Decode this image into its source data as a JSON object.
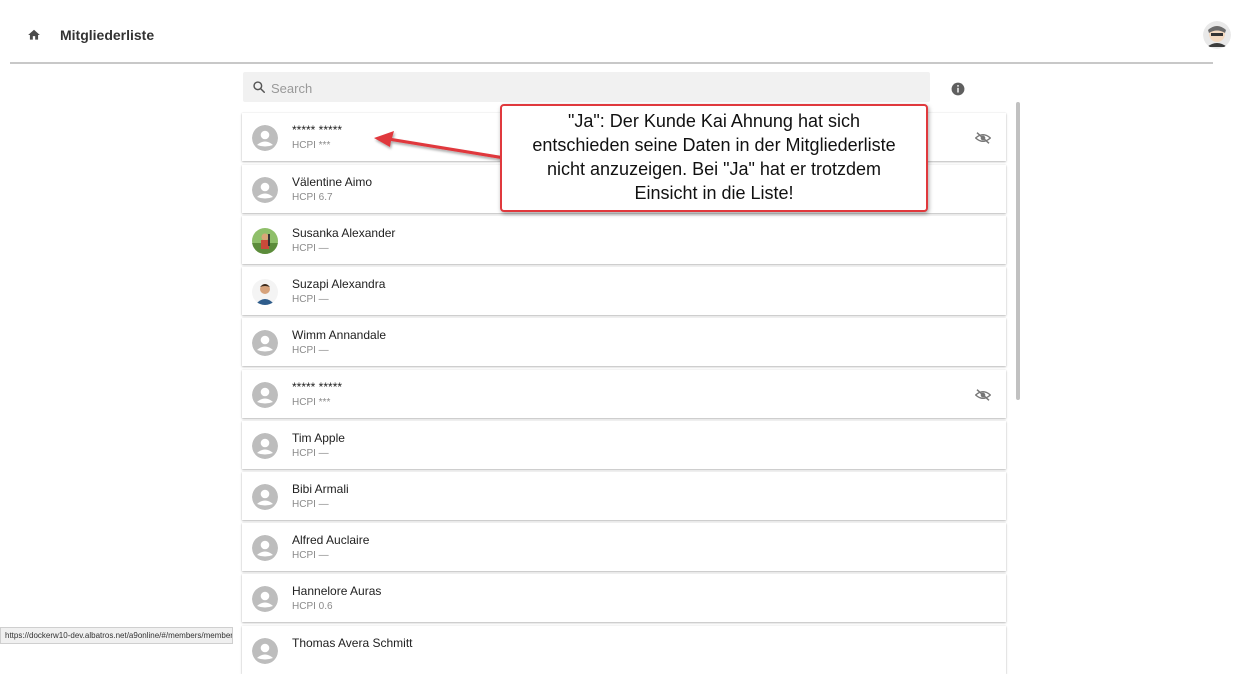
{
  "header": {
    "title": "Mitgliederliste",
    "home_icon": "home-icon",
    "avatar_icon": "user-avatar"
  },
  "search": {
    "placeholder": "Search",
    "value": ""
  },
  "info_icon": "info-icon",
  "members": [
    {
      "name": "***** *****",
      "hcp": "HCPI ***",
      "hidden": true,
      "avatar": "default"
    },
    {
      "name": "Välentine Aimo",
      "hcp": "HCPI 6.7",
      "hidden": false,
      "avatar": "default"
    },
    {
      "name": "Susanka Alexander",
      "hcp": "HCPI —",
      "hidden": false,
      "avatar": "photo"
    },
    {
      "name": "Suzapi Alexandra",
      "hcp": "HCPI —",
      "hidden": false,
      "avatar": "photo"
    },
    {
      "name": "Wimm Annandale",
      "hcp": "HCPI —",
      "hidden": false,
      "avatar": "default"
    },
    {
      "name": "***** *****",
      "hcp": "HCPI ***",
      "hidden": true,
      "avatar": "default"
    },
    {
      "name": "Tim Apple",
      "hcp": "HCPI —",
      "hidden": false,
      "avatar": "default"
    },
    {
      "name": "Bibi Armali",
      "hcp": "HCPI —",
      "hidden": false,
      "avatar": "default"
    },
    {
      "name": "Alfred Auclaire",
      "hcp": "HCPI —",
      "hidden": false,
      "avatar": "default"
    },
    {
      "name": "Hannelore Auras",
      "hcp": "HCPI 0.6",
      "hidden": false,
      "avatar": "default"
    },
    {
      "name": "Thomas Avera Schmitt",
      "hcp": "",
      "hidden": false,
      "avatar": "default"
    }
  ],
  "callout": {
    "lines": [
      "\"Ja\": Der Kunde Kai Ahnung hat sich",
      "entschieden seine Daten in der Mitgliederliste",
      "nicht anzuzeigen. Bei \"Ja\" hat er trotzdem",
      "Einsicht in die Liste!"
    ],
    "border_color": "#e0393d"
  },
  "status_url": "https://dockerw10-dev.albatros.net/a9online/#/members/member"
}
